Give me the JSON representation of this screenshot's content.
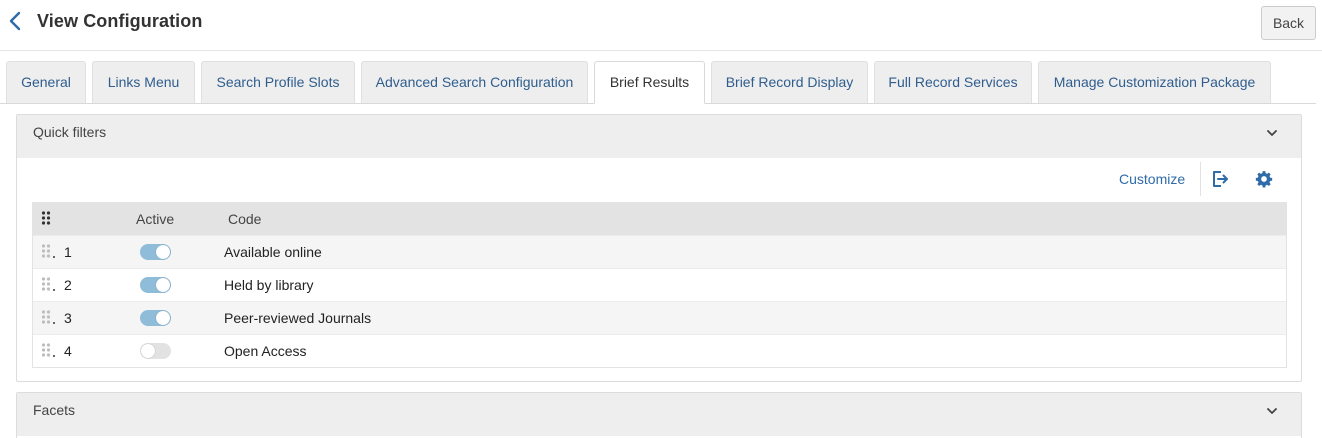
{
  "header": {
    "title": "View Configuration",
    "back_label": "Back",
    "back_icon": "chevron-left-icon"
  },
  "tabs": [
    {
      "label": "General",
      "active": false
    },
    {
      "label": "Links Menu",
      "active": false
    },
    {
      "label": "Search Profile Slots",
      "active": false
    },
    {
      "label": "Advanced Search Configuration",
      "active": false
    },
    {
      "label": "Brief Results",
      "active": true
    },
    {
      "label": "Brief Record Display",
      "active": false
    },
    {
      "label": "Full Record Services",
      "active": false
    },
    {
      "label": "Manage Customization Package",
      "active": false
    }
  ],
  "quick_filters": {
    "title": "Quick filters",
    "customize_label": "Customize",
    "icons": {
      "export": "export-icon",
      "settings": "gear-icon",
      "collapse": "chevron-down-icon"
    },
    "columns": {
      "active": "Active",
      "code": "Code"
    },
    "rows": [
      {
        "num": "1",
        "active": true,
        "code": "Available online"
      },
      {
        "num": "2",
        "active": true,
        "code": "Held by library"
      },
      {
        "num": "3",
        "active": true,
        "code": "Peer-reviewed Journals"
      },
      {
        "num": "4",
        "active": false,
        "code": "Open Access"
      }
    ]
  },
  "facets": {
    "title": "Facets"
  },
  "colors": {
    "link": "#2f6ba8",
    "tab_text": "#2f5d8e",
    "toggle_on": "#8fbcd9",
    "toggle_off": "#e2e2e2",
    "panel_header": "#eeeeee"
  }
}
